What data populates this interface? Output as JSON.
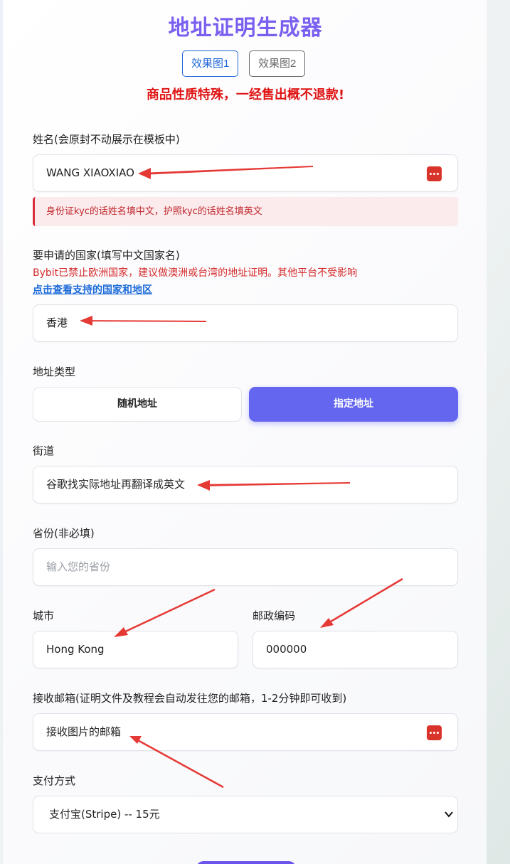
{
  "page": {
    "title": "地址证明生成器",
    "tabs": [
      "效果图1",
      "效果图2"
    ],
    "warning": "商品性质特殊，一经售出概不退款!"
  },
  "name_field": {
    "label": "姓名(会原封不动展示在模板中)",
    "value": "WANG XIAOXIAO",
    "alert": "身份证kyc的话姓名填中文，护照kyc的话姓名填英文"
  },
  "country_field": {
    "label": "要申请的国家(填写中文国家名)",
    "note": "Bybit已禁止欧洲国家，建议做澳洲或台湾的地址证明。其他平台不受影响",
    "link": "点击查看支持的国家和地区",
    "value": "香港"
  },
  "address_type": {
    "label": "地址类型",
    "options": [
      "随机地址",
      "指定地址"
    ],
    "selected": "指定地址"
  },
  "street_field": {
    "label": "街道",
    "value": "谷歌找实际地址再翻译成英文"
  },
  "province_field": {
    "label": "省份(非必填)",
    "placeholder": "输入您的省份"
  },
  "city_field": {
    "label": "城市",
    "value": "Hong Kong"
  },
  "postal_field": {
    "label": "邮政编码",
    "value": "000000"
  },
  "email_field": {
    "label": "接收邮箱(证明文件及教程会自动发往您的邮箱，1-2分钟即可收到)",
    "value": "接收图片的邮箱"
  },
  "payment_field": {
    "label": "支付方式",
    "selected": "支付宝(Stripe) -- 15元"
  },
  "colors": {
    "title": "#7a5ff0",
    "warning": "#e01515",
    "accent": "#6466f0",
    "link": "#1d6bd8",
    "annotation_arrow": "#e53935"
  },
  "icons": [
    "password-manager-icon",
    "chevron-down-icon",
    "red-arrow-annotation"
  ]
}
